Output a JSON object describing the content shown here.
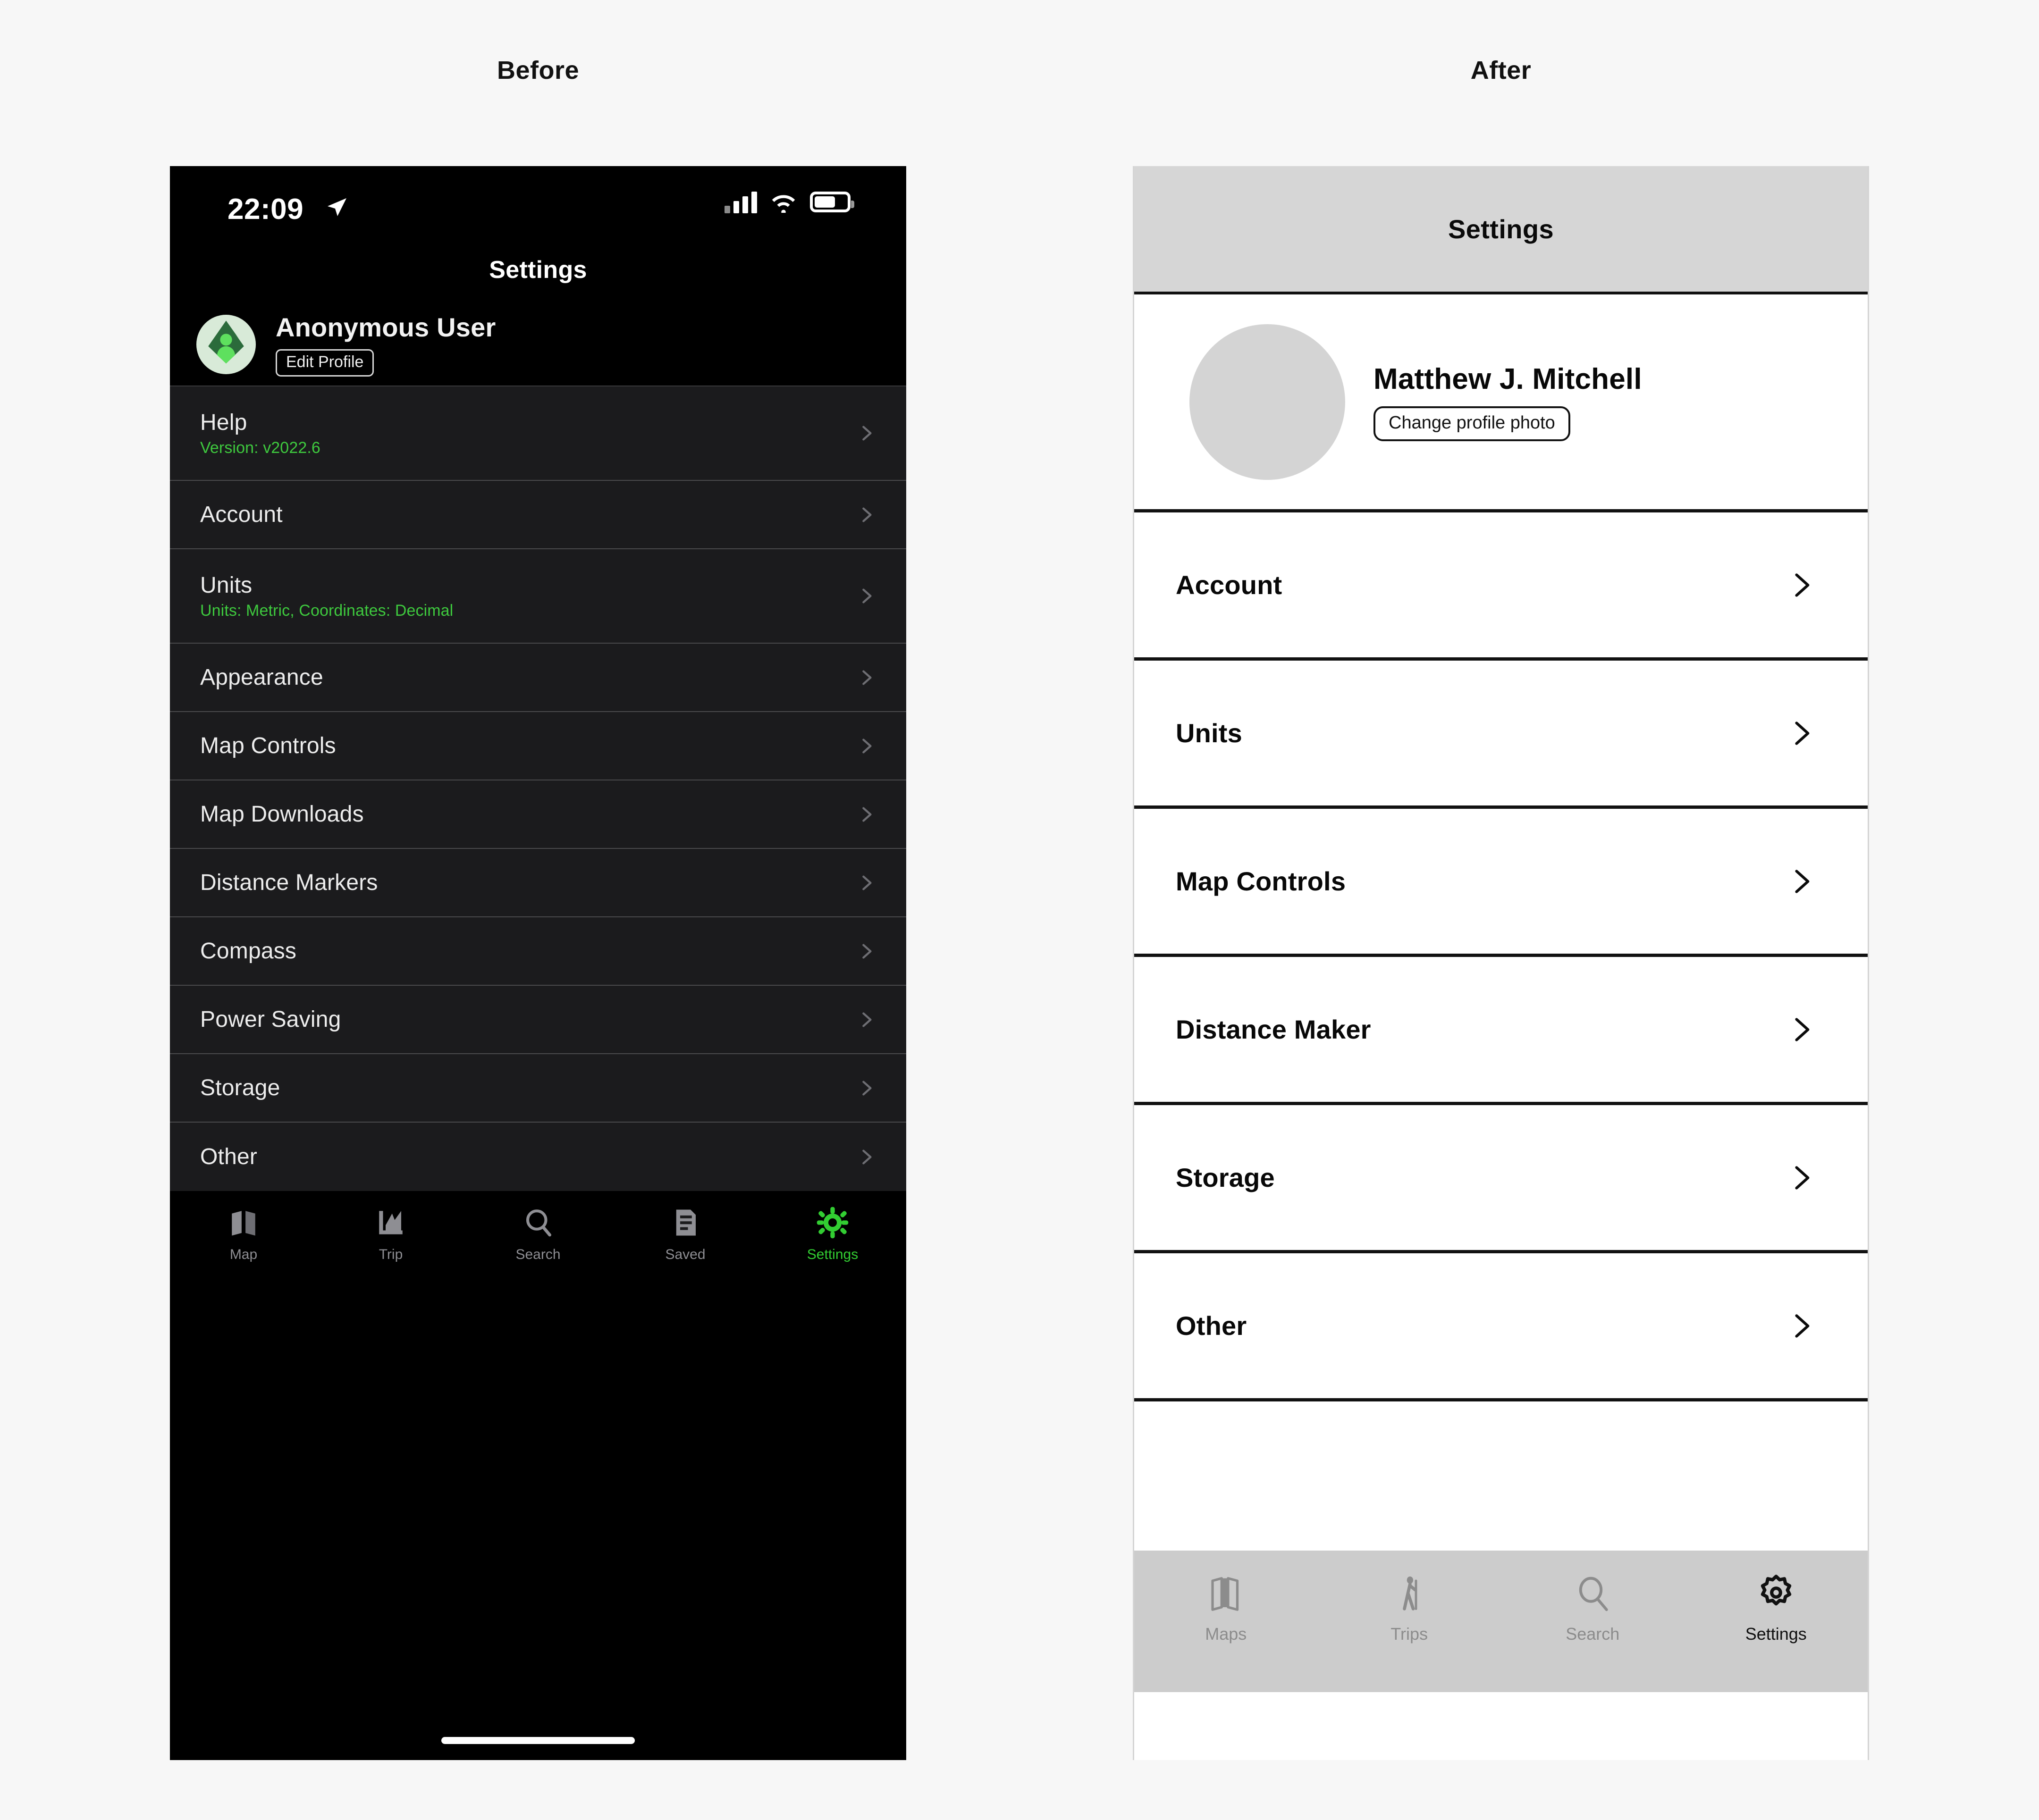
{
  "captions": {
    "before": "Before",
    "after": "After"
  },
  "before": {
    "status_bar": {
      "time": "22:09",
      "location_icon": "location-arrow-icon",
      "signal_icon": "cellular-signal-icon",
      "wifi_icon": "wifi-icon",
      "battery_icon": "battery-icon"
    },
    "nav_title": "Settings",
    "profile": {
      "avatar_icon": "mountain-person-avatar-icon",
      "name": "Anonymous User",
      "edit_button": "Edit Profile"
    },
    "rows": [
      {
        "title": "Help",
        "subtitle": "Version: v2022.6"
      },
      {
        "title": "Account",
        "subtitle": ""
      },
      {
        "title": "Units",
        "subtitle": "Units: Metric, Coordinates: Decimal"
      },
      {
        "title": "Appearance",
        "subtitle": ""
      },
      {
        "title": "Map Controls",
        "subtitle": ""
      },
      {
        "title": "Map Downloads",
        "subtitle": ""
      },
      {
        "title": "Distance Markers",
        "subtitle": ""
      },
      {
        "title": "Compass",
        "subtitle": ""
      },
      {
        "title": "Power Saving",
        "subtitle": ""
      },
      {
        "title": "Storage",
        "subtitle": ""
      },
      {
        "title": "Other",
        "subtitle": ""
      }
    ],
    "tabs": [
      {
        "label": "Map",
        "icon": "map-icon",
        "active": false
      },
      {
        "label": "Trip",
        "icon": "chart-trip-icon",
        "active": false
      },
      {
        "label": "Search",
        "icon": "search-icon",
        "active": false
      },
      {
        "label": "Saved",
        "icon": "saved-list-icon",
        "active": false
      },
      {
        "label": "Settings",
        "icon": "gear-icon",
        "active": true
      }
    ],
    "colors": {
      "accent": "#32cd32",
      "background": "#000000",
      "list_background": "#1b1b1d",
      "subtitle": "#3ec93e"
    }
  },
  "after": {
    "header_title": "Settings",
    "profile": {
      "avatar_icon": "placeholder-avatar-icon",
      "name": "Matthew J. Mitchell",
      "photo_button": "Change profile photo"
    },
    "rows": [
      {
        "title": "Account"
      },
      {
        "title": "Units"
      },
      {
        "title": "Map Controls"
      },
      {
        "title": "Distance Maker"
      },
      {
        "title": "Storage"
      },
      {
        "title": "Other"
      }
    ],
    "tabs": [
      {
        "label": "Maps",
        "icon": "map-icon",
        "active": false
      },
      {
        "label": "Trips",
        "icon": "hiker-icon",
        "active": false
      },
      {
        "label": "Search",
        "icon": "search-icon",
        "active": false
      },
      {
        "label": "Settings",
        "icon": "gear-icon",
        "active": true
      }
    ],
    "colors": {
      "header_background": "#d6d6d6",
      "tabbar_background": "#cccccc",
      "avatar_fill": "#d4d4d4",
      "border": "#111111"
    }
  }
}
